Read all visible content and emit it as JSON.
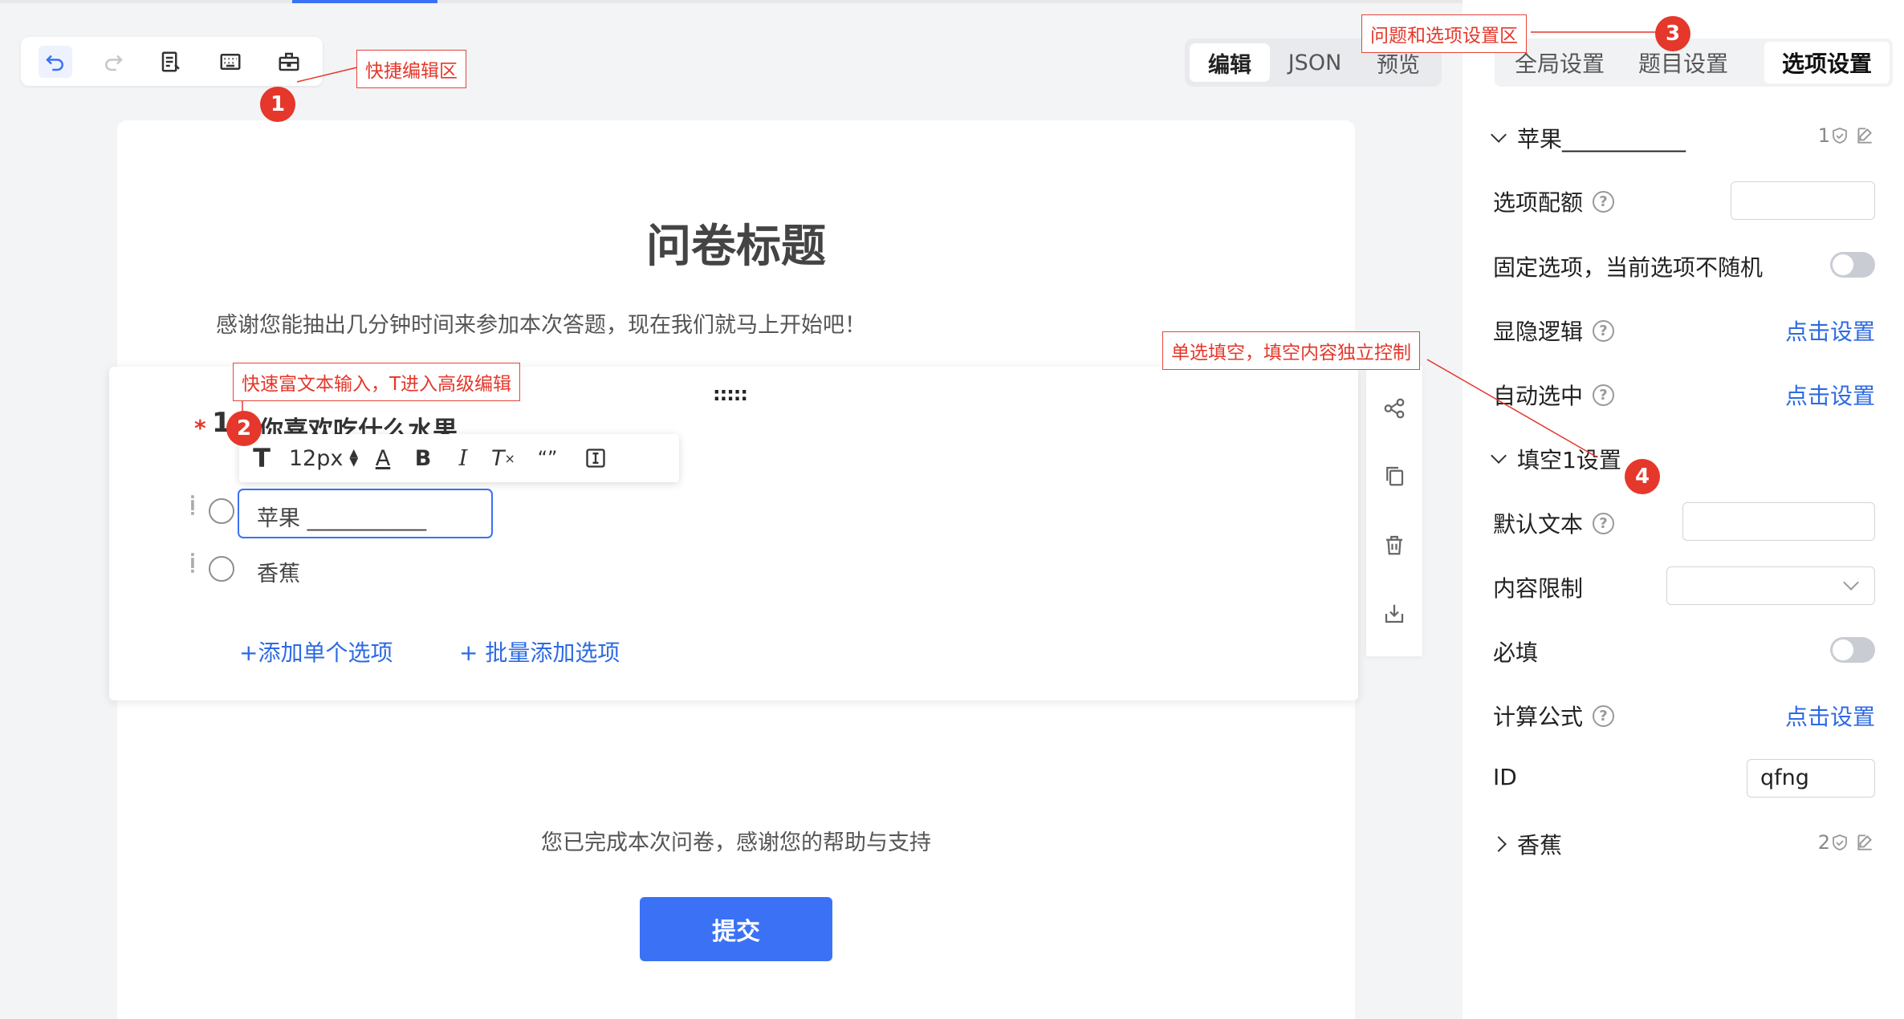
{
  "toolbar": {
    "buttons": [
      {
        "name": "undo-icon"
      },
      {
        "name": "redo-icon"
      },
      {
        "name": "edit-doc-icon"
      },
      {
        "name": "keyboard-icon"
      },
      {
        "name": "toolkit-icon"
      }
    ]
  },
  "mode_tabs": [
    {
      "label": "编辑",
      "active": true
    },
    {
      "label": "JSON",
      "active": false
    },
    {
      "label": "预览",
      "active": false
    }
  ],
  "survey": {
    "title": "问卷标题",
    "description": "感谢您能抽出几分钟时间来参加本次答题，现在我们就马上开始吧！",
    "finish_text": "您已完成本次问卷，感谢您的帮助与支持",
    "submit_label": "提交"
  },
  "question": {
    "drag_handle": ":::::",
    "required_mark": "*",
    "number": "1",
    "text": "你喜欢吃什么水果",
    "options": [
      {
        "label": "苹果 ___________"
      },
      {
        "label": "香蕉"
      }
    ],
    "add_single": "+添加单个选项",
    "add_batch": "+ 批量添加选项"
  },
  "richtext_toolbar": {
    "font_size": "12px",
    "tools": [
      "text-style-icon",
      "font-size-stepper",
      "font-color-icon",
      "bold-icon",
      "italic-icon",
      "clear-format-icon",
      "blank-insert-icon",
      "input-field-icon"
    ]
  },
  "side_tools": [
    "logic-icon",
    "copy-icon",
    "delete-icon",
    "export-icon"
  ],
  "panel": {
    "tabs": [
      {
        "label": "全局设置",
        "active": false
      },
      {
        "label": "题目设置",
        "active": false
      },
      {
        "label": "选项设置",
        "active": true
      }
    ],
    "option1_header": "苹果___________",
    "option1_index": "1",
    "quota_label": "选项配额",
    "fixed_label": "固定选项，当前选项不随机",
    "visibility_label": "显隐逻辑",
    "auto_select_label": "自动选中",
    "set_link": "点击设置",
    "blank_header": "填空1设置",
    "default_text_label": "默认文本",
    "content_limit_label": "内容限制",
    "required_label": "必填",
    "formula_label": "计算公式",
    "id_label": "ID",
    "id_value": "qfng",
    "option2_header": "香蕉",
    "option2_index": "2",
    "help": "?"
  },
  "annotations": [
    {
      "num": "1",
      "text": "快捷编辑区"
    },
    {
      "num": "2",
      "text": "快速富文本输入，T进入高级编辑"
    },
    {
      "num": "3",
      "text": "问题和选项设置区"
    },
    {
      "num": "4",
      "text": "单选填空，填空内容独立控制"
    }
  ],
  "colors": {
    "accent": "#3b71f5",
    "annotation": "#e5372b",
    "link": "#2d6ae3"
  }
}
